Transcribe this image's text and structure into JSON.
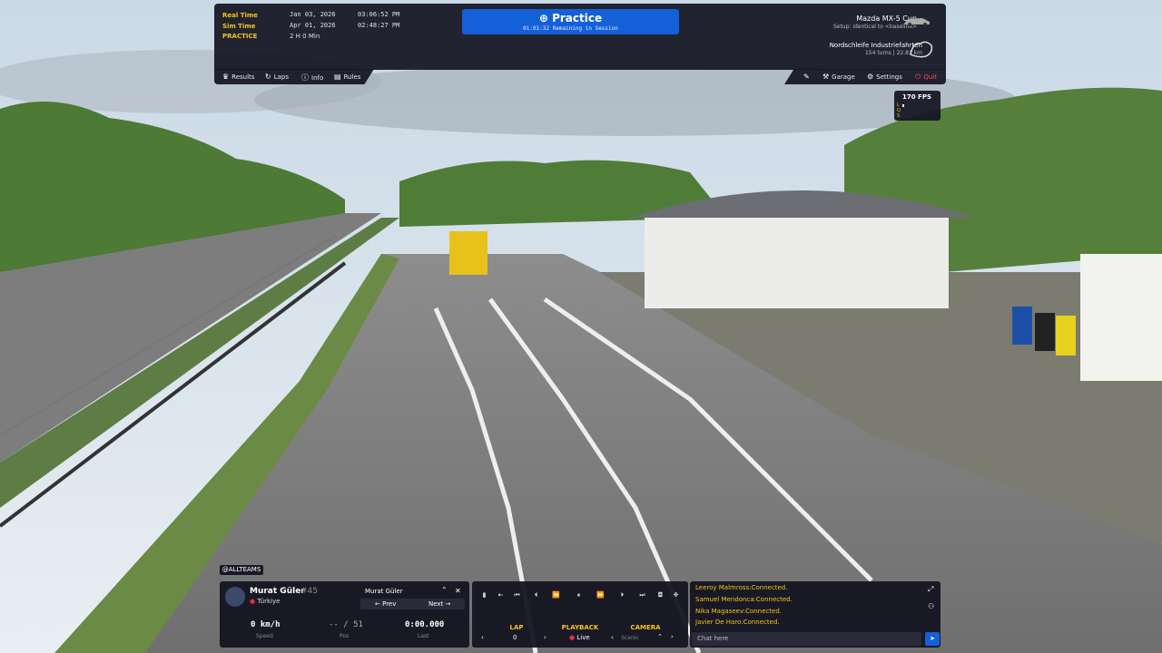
{
  "topbar": {
    "real_time_label": "Real Time",
    "real_time_date": "Jan 03, 2026",
    "real_time_clock": "03:06:52 PM",
    "sim_time_label": "Sim Time",
    "sim_time_date": "Apr 01, 2026",
    "sim_time_clock": "02:48:27 PM",
    "session_type_label": "PRACTICE",
    "session_length": "2 H 0 Min",
    "session_title": "Practice",
    "session_remaining": "01:01:32 Remaining in Session",
    "car_name": "Mazda MX-5 Cup",
    "car_setup": "Setup: identical to <baseline>",
    "track_name": "Nordschleife Industriefahrten",
    "track_details": "154 turns  |  22.81 km",
    "tabs": {
      "results": "Results",
      "laps": "Laps",
      "info": "Info",
      "rules": "Rules"
    },
    "right_tabs": {
      "garage": "Garage",
      "settings": "Settings",
      "quit": "Quit"
    }
  },
  "fps": {
    "value": "170 FPS",
    "bars": [
      "L",
      "Q",
      "S"
    ]
  },
  "driver_panel": {
    "team_tag": "@ALLTEAMS",
    "driver_name": "Murat Güler",
    "car_number": "#45",
    "country": "Türkiye",
    "selected_driver": "Murat Güler",
    "prev_label": "← Prev",
    "next_label": "Next →",
    "speed_value": "0 km/h",
    "speed_label": "Speed",
    "pos_value": "-- / 51",
    "pos_label": "Pos",
    "last_value": "0:00.000",
    "last_label": "Last"
  },
  "playback": {
    "lap_label": "LAP",
    "lap_value": "0",
    "playback_label": "PLAYBACK",
    "playback_value": "Live",
    "camera_label": "CAMERA",
    "camera_value": "Scenic"
  },
  "chat": {
    "messages": [
      "Leeroy Malmross:Connected.",
      "Samuel Mendonca:Connected.",
      "Nika Magaseev:Connected.",
      "Javier De Haro:Connected."
    ],
    "placeholder": "Chat here"
  },
  "colors": {
    "accent": "#1460d8",
    "label_yellow": "#f5c518",
    "quit_red": "#ff4a4a",
    "live_red": "#e0304a"
  }
}
